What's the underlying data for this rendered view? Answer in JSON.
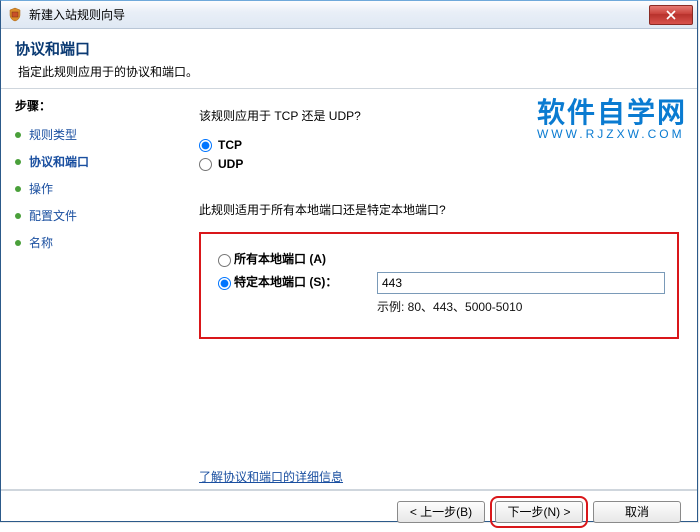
{
  "window": {
    "title": "新建入站规则向导"
  },
  "header": {
    "title": "协议和端口",
    "subtitle": "指定此规则应用于的协议和端口。"
  },
  "sidebar": {
    "title": "步骤：",
    "items": [
      {
        "label": "规则类型",
        "current": false
      },
      {
        "label": "协议和端口",
        "current": true
      },
      {
        "label": "操作",
        "current": false
      },
      {
        "label": "配置文件",
        "current": false
      },
      {
        "label": "名称",
        "current": false
      }
    ]
  },
  "content": {
    "question1": "该规则应用于 TCP 还是 UDP?",
    "tcp_label": "TCP",
    "udp_label": "UDP",
    "protocol_selected": "tcp",
    "question2": "此规则适用于所有本地端口还是特定本地端口?",
    "all_ports_label": "所有本地端口 (A)",
    "specific_ports_label": "特定本地端口 (S)：",
    "port_scope_selected": "specific",
    "port_value": "443",
    "example_prefix": "示例: ",
    "example_value": "80、443、5000-5010",
    "learn_more": "了解协议和端口的详细信息"
  },
  "footer": {
    "back": "< 上一步(B)",
    "next": "下一步(N) >",
    "cancel": "取消"
  },
  "watermark": {
    "big": "软件自学网",
    "small": "WWW.RJZXW.COM"
  }
}
